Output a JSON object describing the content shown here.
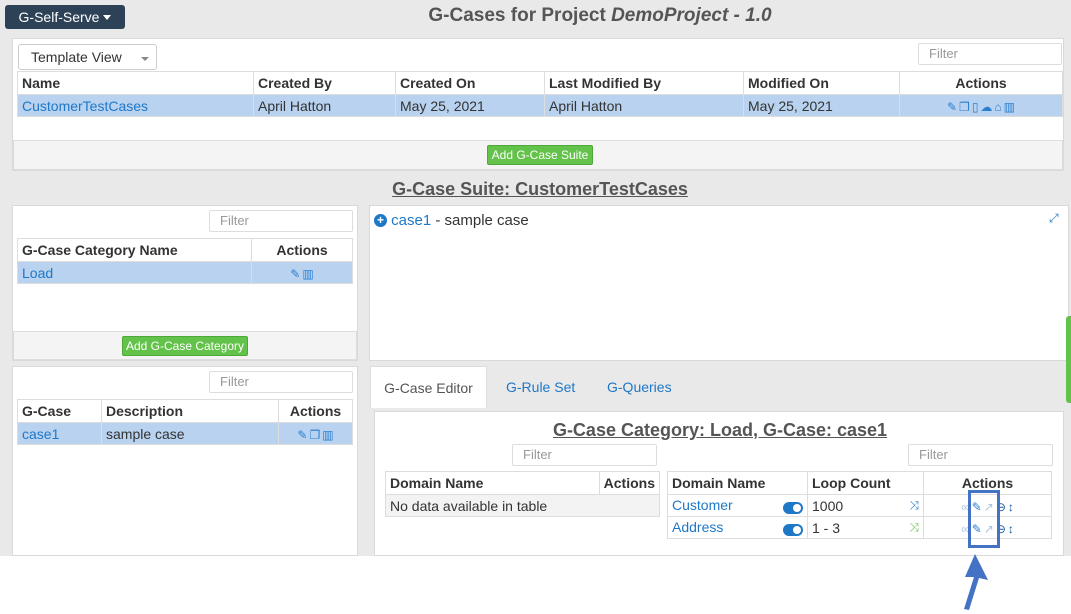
{
  "app": {
    "brand_label": "G-Self-Serve"
  },
  "title": {
    "prefix": "G-Cases for Project ",
    "project": "DemoProject",
    "suffix": " - 1.0"
  },
  "suites": {
    "view_select": "Template View",
    "filter_placeholder": "Filter",
    "columns": [
      "Name",
      "Created By",
      "Created On",
      "Last Modified By",
      "Modified On",
      "Actions"
    ],
    "rows": [
      {
        "name": "CustomerTestCases",
        "created_by": "April Hatton",
        "created_on": "May 25, 2021",
        "modified_by": "April Hatton",
        "modified_on": "May 25, 2021"
      }
    ],
    "add_button": "Add G-Case Suite"
  },
  "suite_heading": "G-Case Suite: CustomerTestCases",
  "categories": {
    "filter_placeholder": "Filter",
    "columns": [
      "G-Case Category Name",
      "Actions"
    ],
    "rows": [
      {
        "name": "Load"
      }
    ],
    "add_button": "Add G-Case Category"
  },
  "cases": {
    "filter_placeholder": "Filter",
    "columns": [
      "G-Case",
      "Description",
      "Actions"
    ],
    "rows": [
      {
        "name": "case1",
        "description": "sample case"
      }
    ]
  },
  "tree": {
    "case_name": "case1",
    "case_desc": " - sample case"
  },
  "tabs": [
    "G-Case Editor",
    "G-Rule Set",
    "G-Queries"
  ],
  "editor": {
    "heading": "G-Case Category: Load, G-Case: case1",
    "left_filter_placeholder": "Filter",
    "left_columns": [
      "Domain Name",
      "Actions"
    ],
    "left_empty": "No data available in table",
    "right_filter_placeholder": "Filter",
    "right_columns": [
      "Domain Name",
      "Loop Count",
      "Actions"
    ],
    "rows": [
      {
        "domain": "Customer",
        "loop_count": "1000"
      },
      {
        "domain": "Address",
        "loop_count": "1 - 3"
      }
    ]
  },
  "colors": {
    "accent": "#1e78c8",
    "selected_row": "#b8d2ef",
    "add_green": "#63c24a",
    "brand": "#2e4257",
    "callout": "#4472c4"
  }
}
